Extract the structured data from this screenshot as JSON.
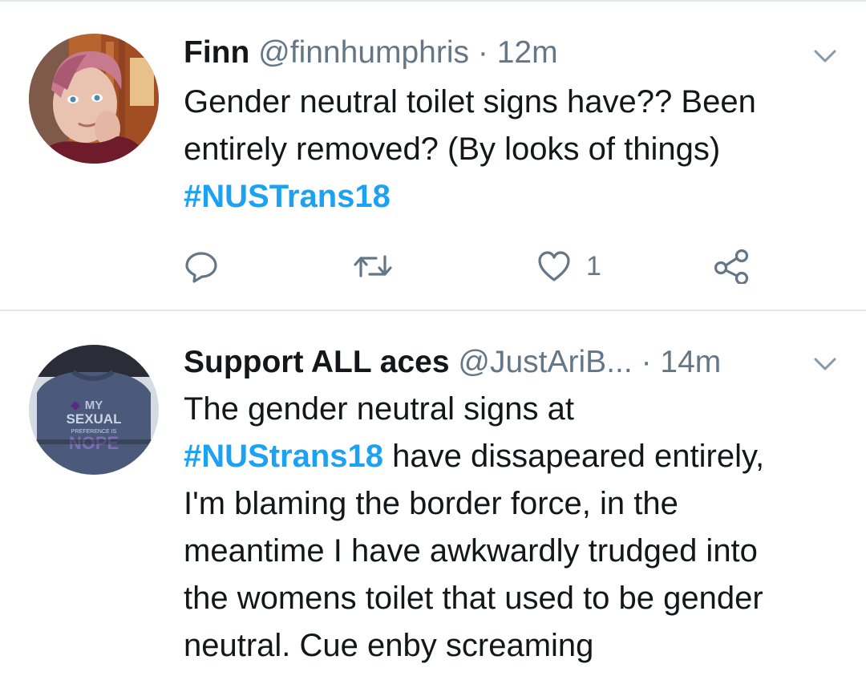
{
  "tweets": [
    {
      "display_name": "Finn",
      "handle": "@finnhumphris",
      "separator": "·",
      "time": "12m",
      "text_lines": [
        "Gender neutral toilet signs have?? Been",
        "entirely removed? (By looks of things)"
      ],
      "hashtag": "#NUSTrans18",
      "actions": {
        "reply_icon": "reply-icon",
        "retweet_icon": "retweet-icon",
        "like_icon": "heart-icon",
        "like_count": "1",
        "share_icon": "share-icon"
      }
    },
    {
      "display_name": "Support ALL aces",
      "handle": "@JustAriB...",
      "separator": "·",
      "time": "14m",
      "text_line_1": "The gender neutral signs at",
      "hashtag": "#NUStrans18",
      "text_after_hashtag": "have dissapeared entirely,",
      "text_lines_rest": [
        "I'm blaming the border force, in the",
        "meantime I have awkwardly trudged into",
        "the womens toilet that used to be gender",
        "neutral. Cue enby screaming"
      ],
      "avatar_sweater_text": [
        "MY",
        "SEXUAL",
        "PREFERENCE IS",
        "NOPE"
      ]
    }
  ],
  "colors": {
    "hashtag": "#1da1f2",
    "secondary_text": "#657786",
    "divider": "#e1e8ed"
  }
}
